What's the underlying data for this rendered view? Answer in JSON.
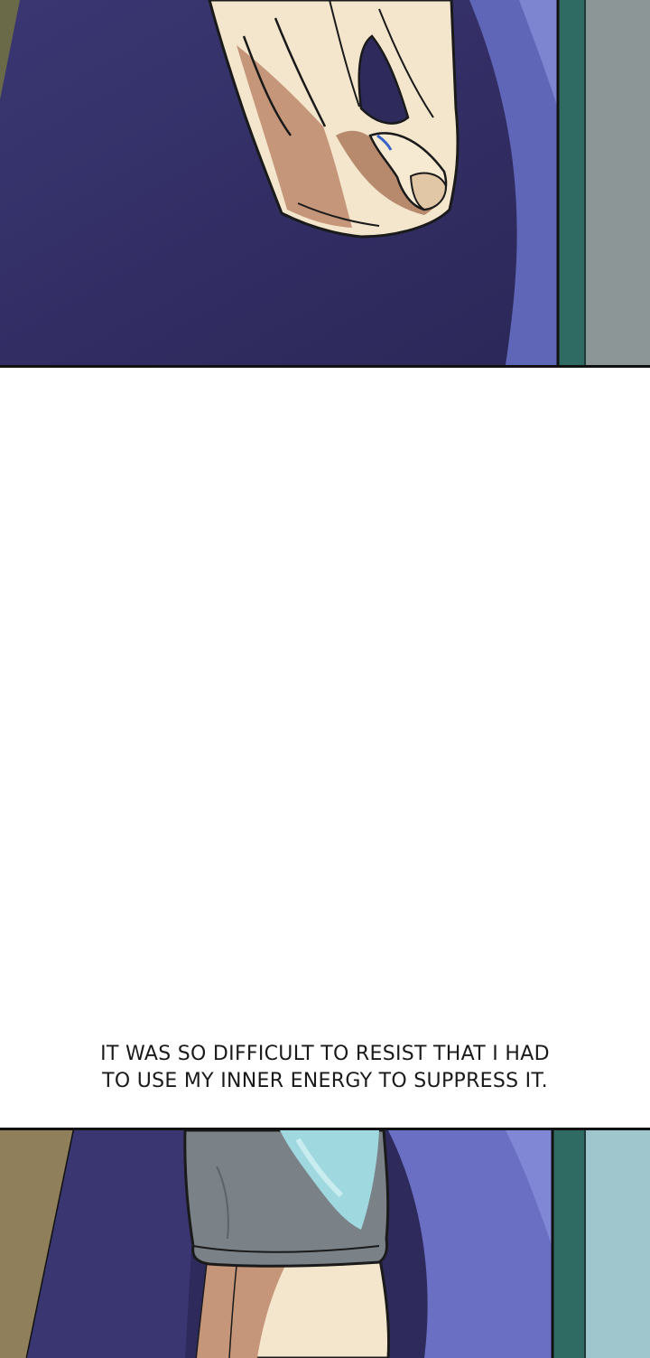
{
  "caption": {
    "line1": "IT WAS SO DIFFICULT TO RESIST THAT I HAD",
    "line2": "TO USE MY INNER ENERGY TO SUPPRESS IT."
  },
  "colors": {
    "robe_dark": "#2e2a5c",
    "robe_mid": "#3a3672",
    "robe_light": "#6a6fc4",
    "door_teal": "#2f6b63",
    "wall_gray": "#8d9697",
    "skin_light": "#f3e6cc",
    "skin_shadow": "#b78a6e",
    "sleeve_gray": "#7a8288",
    "sleeve_highlight": "#9fd8df",
    "floor_tan": "#8f7f5a"
  }
}
